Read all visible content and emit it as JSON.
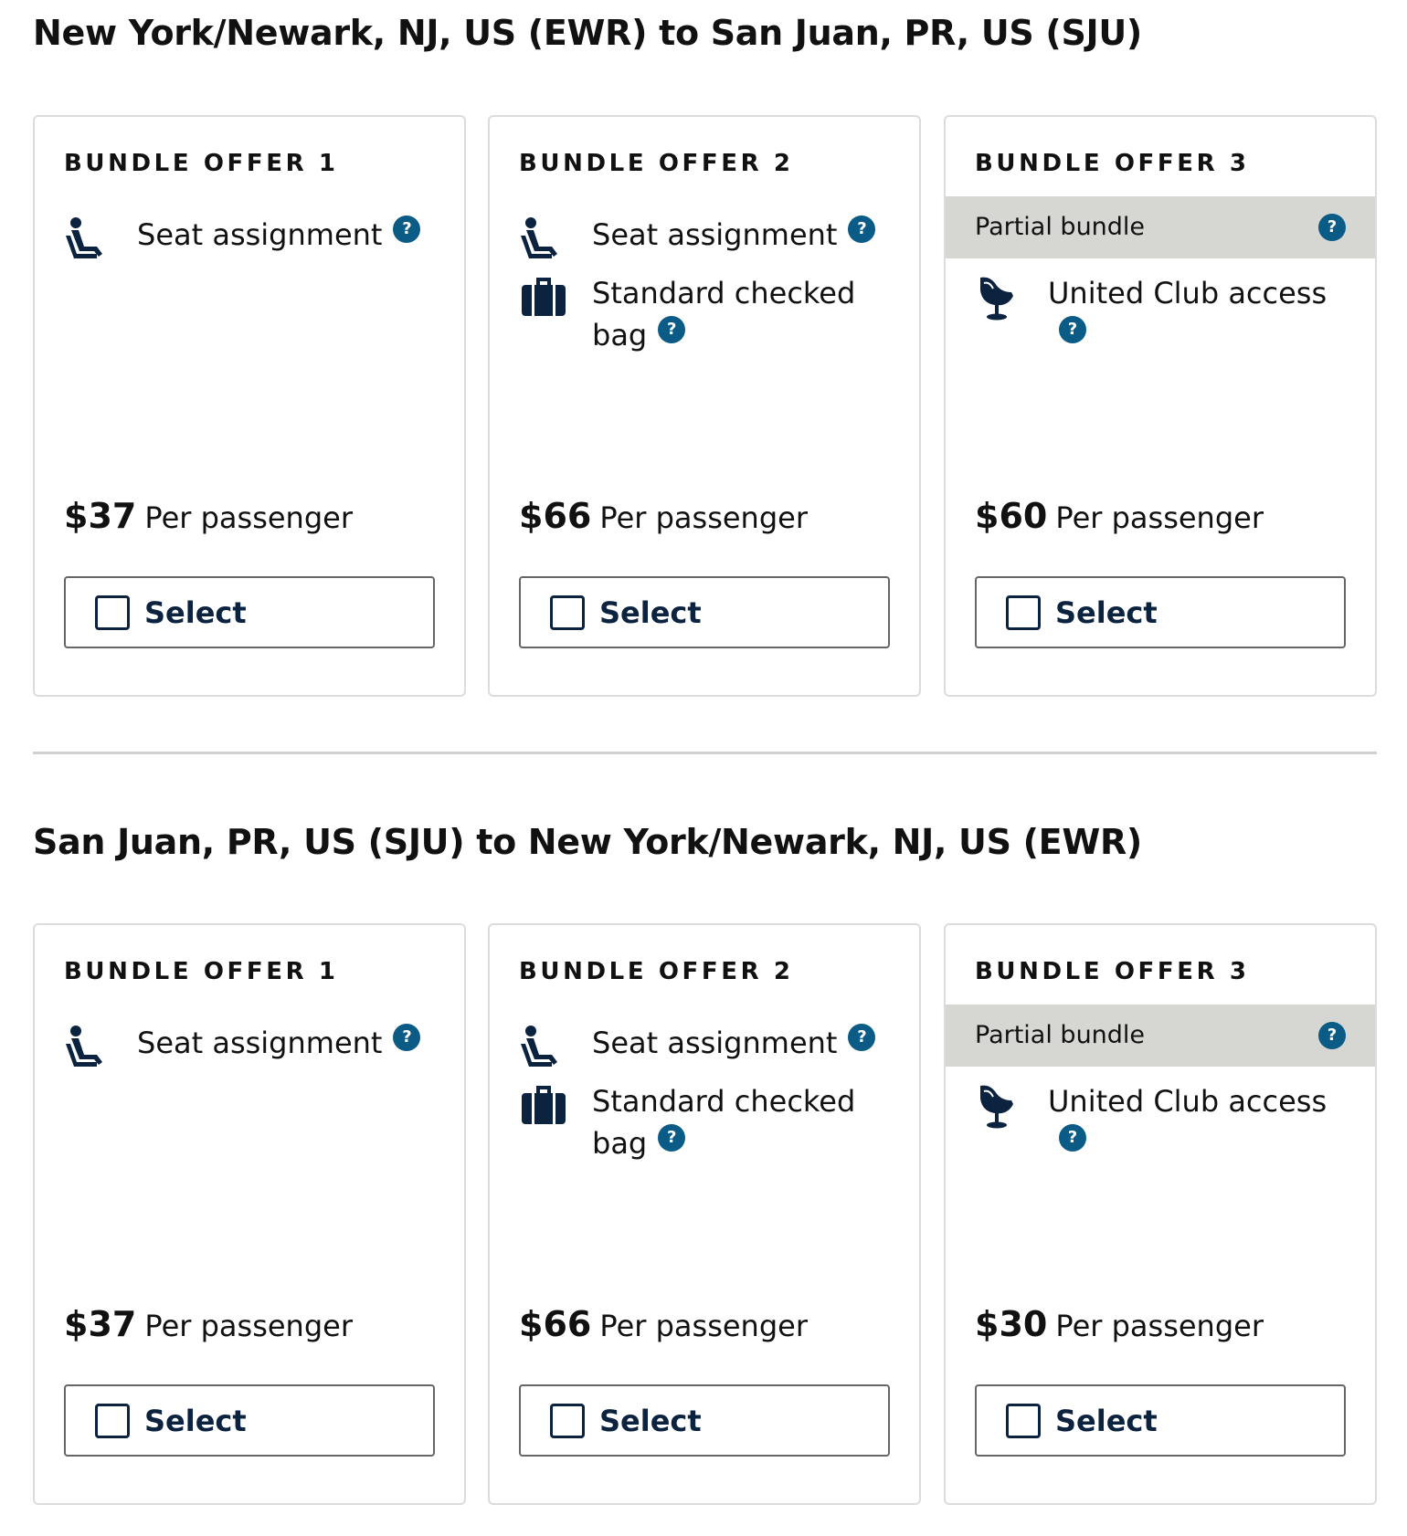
{
  "sections": [
    {
      "title": "New York/Newark, NJ, US (EWR) to San Juan, PR, US (SJU)",
      "offers": [
        {
          "title": "BUNDLE OFFER 1",
          "partial": null,
          "features": [
            {
              "icon": "seat-icon",
              "label": "Seat assignment"
            }
          ],
          "price": "$37",
          "price_suffix": "Per passenger",
          "select_label": "Select"
        },
        {
          "title": "BUNDLE OFFER 2",
          "partial": null,
          "features": [
            {
              "icon": "seat-icon",
              "label": "Seat assignment"
            },
            {
              "icon": "checked-bag-icon",
              "label": "Standard checked bag"
            }
          ],
          "price": "$66",
          "price_suffix": "Per passenger",
          "select_label": "Select"
        },
        {
          "title": "BUNDLE OFFER 3",
          "partial": "Partial bundle",
          "features": [
            {
              "icon": "lounge-chair-icon",
              "label": "United Club access"
            }
          ],
          "price": "$60",
          "price_suffix": "Per passenger",
          "select_label": "Select"
        }
      ]
    },
    {
      "title": "San Juan, PR, US (SJU) to New York/Newark, NJ, US (EWR)",
      "offers": [
        {
          "title": "BUNDLE OFFER 1",
          "partial": null,
          "features": [
            {
              "icon": "seat-icon",
              "label": "Seat assignment"
            }
          ],
          "price": "$37",
          "price_suffix": "Per passenger",
          "select_label": "Select"
        },
        {
          "title": "BUNDLE OFFER 2",
          "partial": null,
          "features": [
            {
              "icon": "seat-icon",
              "label": "Seat assignment"
            },
            {
              "icon": "checked-bag-icon",
              "label": "Standard checked bag"
            }
          ],
          "price": "$66",
          "price_suffix": "Per passenger",
          "select_label": "Select"
        },
        {
          "title": "BUNDLE OFFER 3",
          "partial": "Partial bundle",
          "features": [
            {
              "icon": "lounge-chair-icon",
              "label": "United Club access"
            }
          ],
          "price": "$30",
          "price_suffix": "Per passenger",
          "select_label": "Select"
        }
      ]
    }
  ],
  "help_glyph": "?",
  "colors": {
    "text": "#111111",
    "navy": "#0c2340",
    "help_blue": "#0a5b86",
    "partial_banner": "#d6d6d3",
    "card_border": "#dcdcdc",
    "divider": "#d0d0d0"
  }
}
